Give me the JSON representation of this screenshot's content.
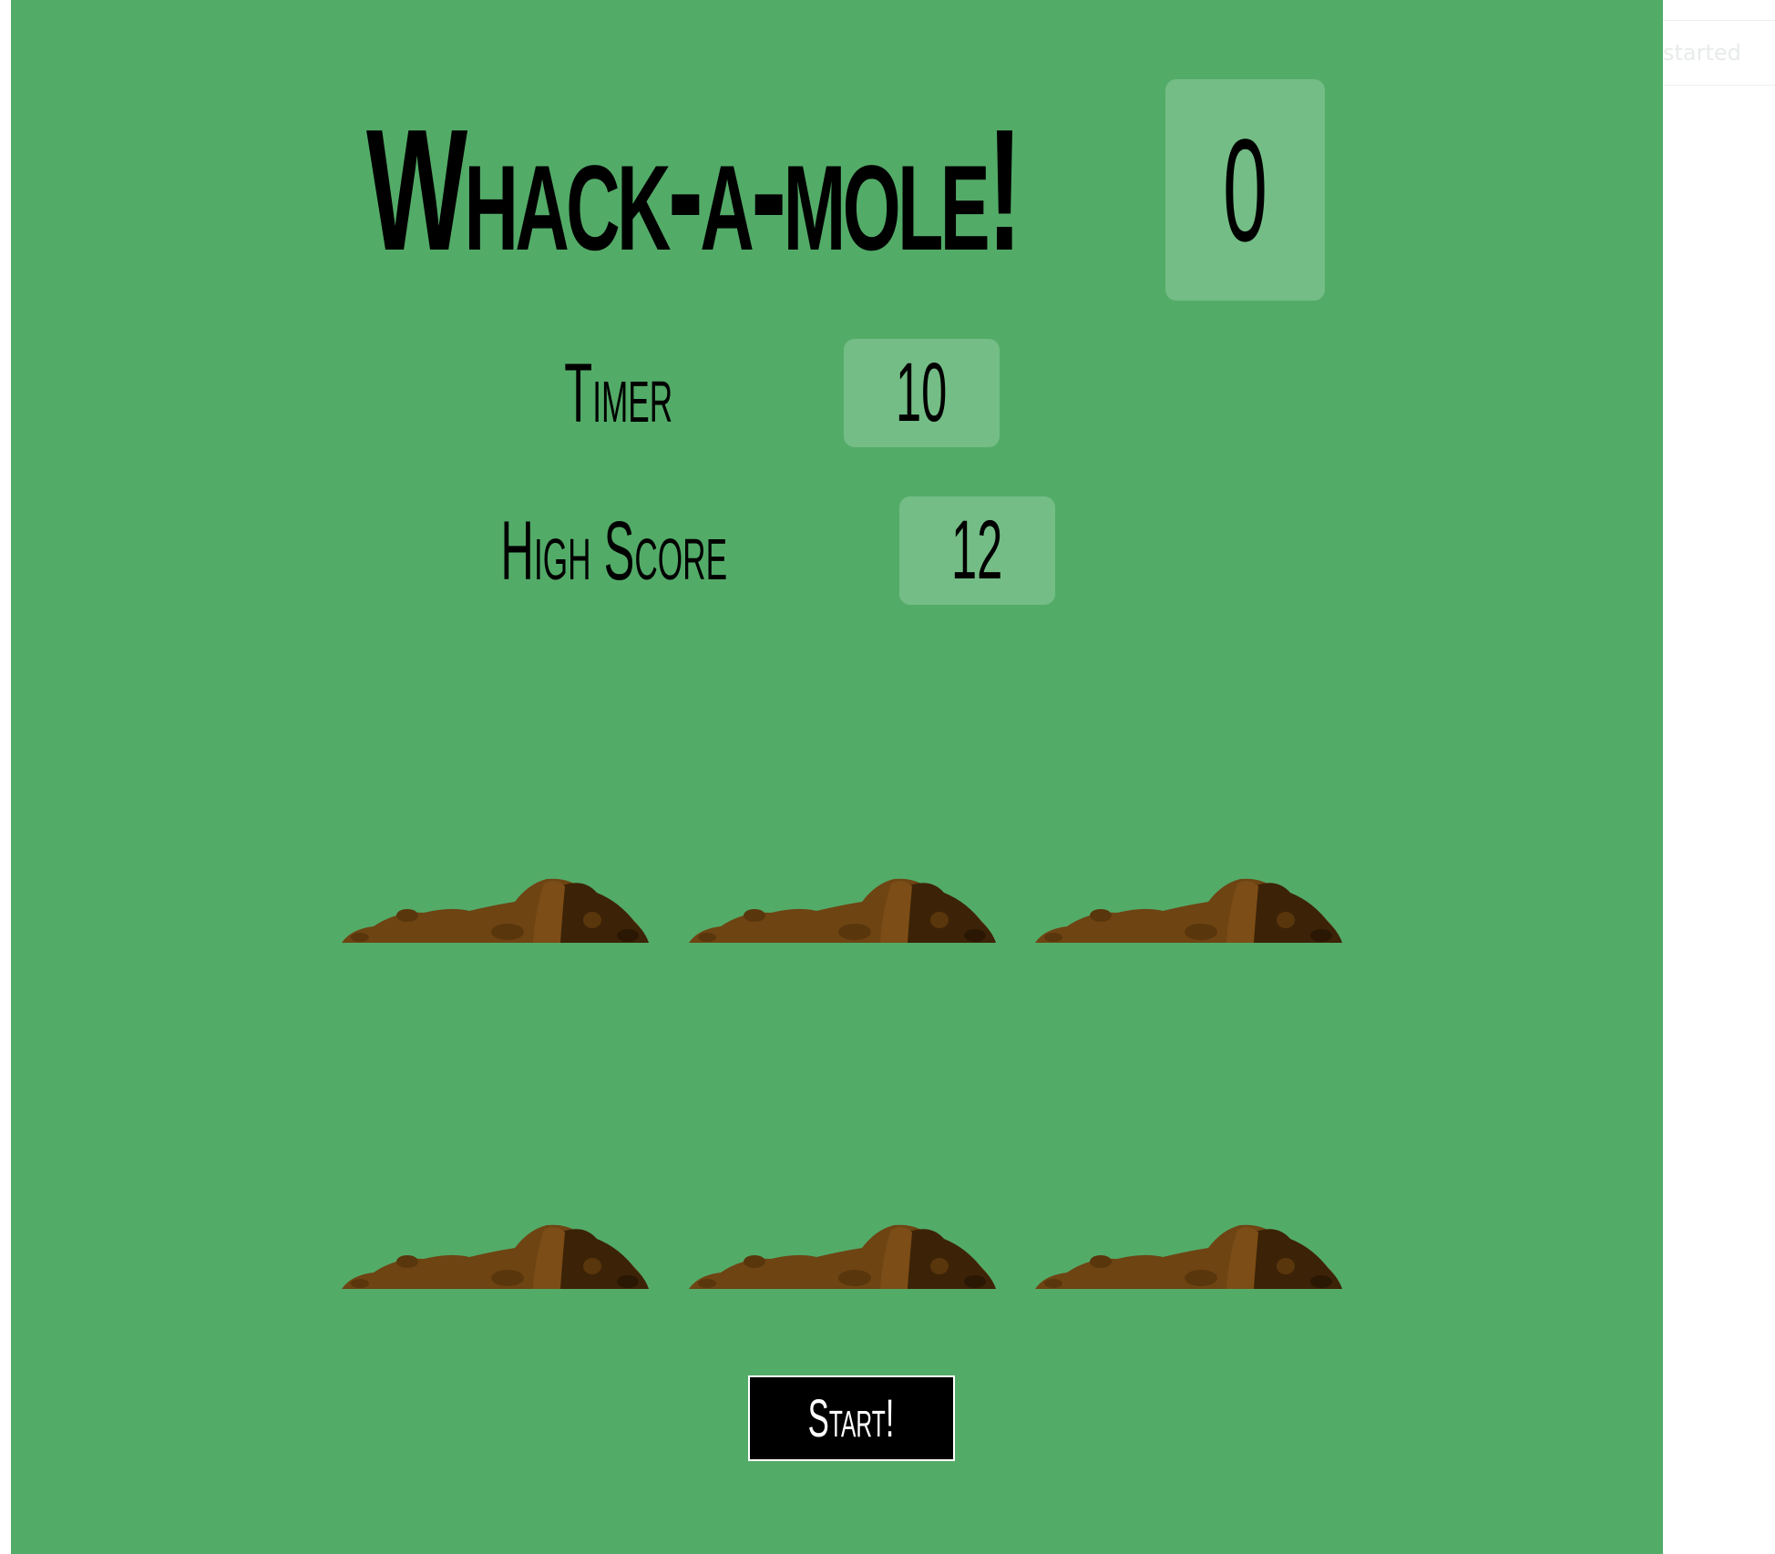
{
  "game": {
    "title": "Whack-a-mole!",
    "score": "0",
    "timer_label": "Timer",
    "timer_value": "10",
    "high_score_label": "High Score",
    "high_score_value": "12",
    "start_label": "Start!"
  },
  "side_panel": {
    "tab_text": "started"
  },
  "colors": {
    "background": "#53ab68",
    "score_box": "#74bd86",
    "dirt_light": "#6e4413",
    "dirt_dark": "#3c2307",
    "button": "#000000"
  },
  "grid": {
    "rows": 2,
    "cols": 3
  }
}
